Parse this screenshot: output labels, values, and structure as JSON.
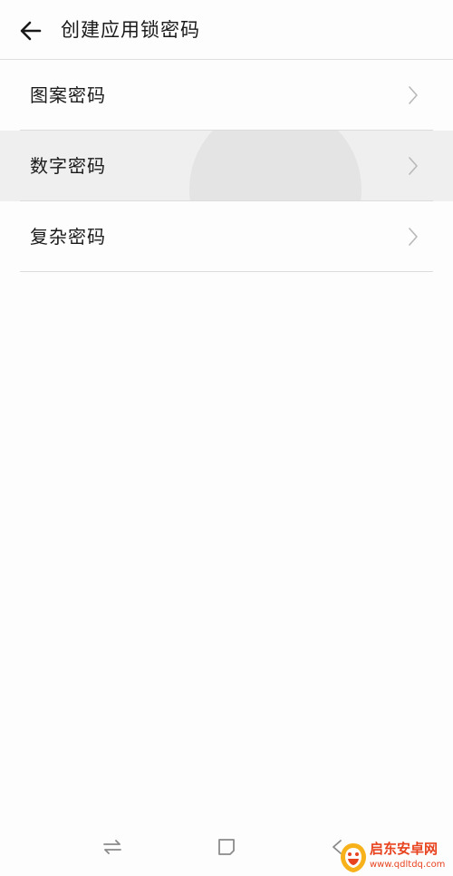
{
  "header": {
    "title": "创建应用锁密码",
    "back_icon": "arrow-left-icon"
  },
  "options": [
    {
      "label": "图案密码",
      "icon": "chevron-right-icon"
    },
    {
      "label": "数字密码",
      "icon": "chevron-right-icon",
      "state": "pressed"
    },
    {
      "label": "复杂密码",
      "icon": "chevron-right-icon"
    }
  ],
  "nav_bar": {
    "buttons": [
      "switch-arrows-icon",
      "square-icon",
      "back-triangle-icon"
    ]
  },
  "watermark": {
    "text": "启东安卓网",
    "url": "www.qdltdq.com"
  },
  "colors": {
    "background": "#fdfdfd",
    "pressed": "#efefef",
    "divider": "#dcdcdc",
    "text": "#1a1a1a",
    "watermark": "#e8431f"
  }
}
